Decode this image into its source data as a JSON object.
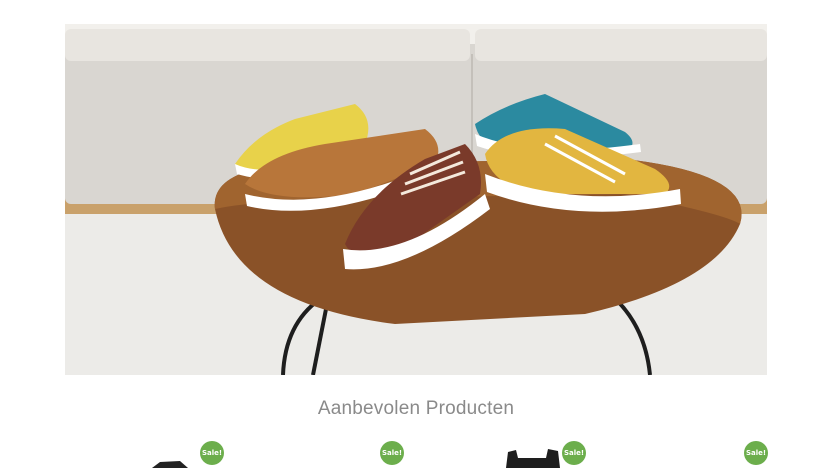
{
  "hero": {
    "image_name": "sneakers-on-coffee-table"
  },
  "featured": {
    "title": "Aanbevolen Producten"
  },
  "products": [
    {
      "badge": "Sale!"
    },
    {
      "badge": "Sale!"
    },
    {
      "badge": "Sale!"
    },
    {
      "badge": "Sale!"
    }
  ],
  "colors": {
    "sale_badge": "#6cae4c",
    "title_text": "#8a8a8a"
  }
}
